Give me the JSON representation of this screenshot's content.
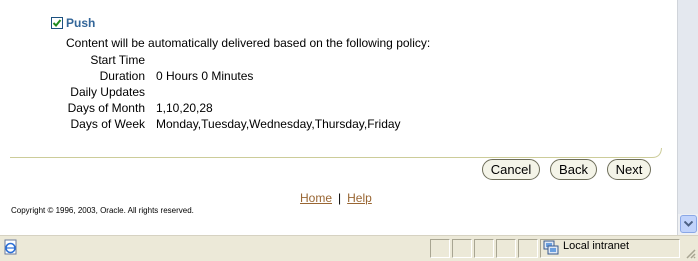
{
  "push": {
    "label": "Push",
    "checked": true,
    "description": "Content will be automatically delivered based on the following policy:"
  },
  "policy": [
    {
      "label": "Start Time",
      "value": ""
    },
    {
      "label": "Duration",
      "value": "0 Hours 0 Minutes"
    },
    {
      "label": "Daily Updates",
      "value": ""
    },
    {
      "label": "Days of Month",
      "value": "1,10,20,28"
    },
    {
      "label": "Days of Week",
      "value": "Monday,Tuesday,Wednesday,Thursday,Friday"
    }
  ],
  "buttons": {
    "cancel": "Cancel",
    "back": "Back",
    "next": "Next"
  },
  "footer": {
    "home": "Home",
    "separator": "|",
    "help": "Help",
    "copyright": "Copyright © 1996, 2003, Oracle. All rights reserved."
  },
  "statusbar": {
    "zone": "Local intranet"
  },
  "colors": {
    "accent": "#336699",
    "link": "#996633",
    "divider": "#cccc99",
    "button_bg": "#f4f4e8",
    "statusbar_bg": "#ece9d8"
  }
}
